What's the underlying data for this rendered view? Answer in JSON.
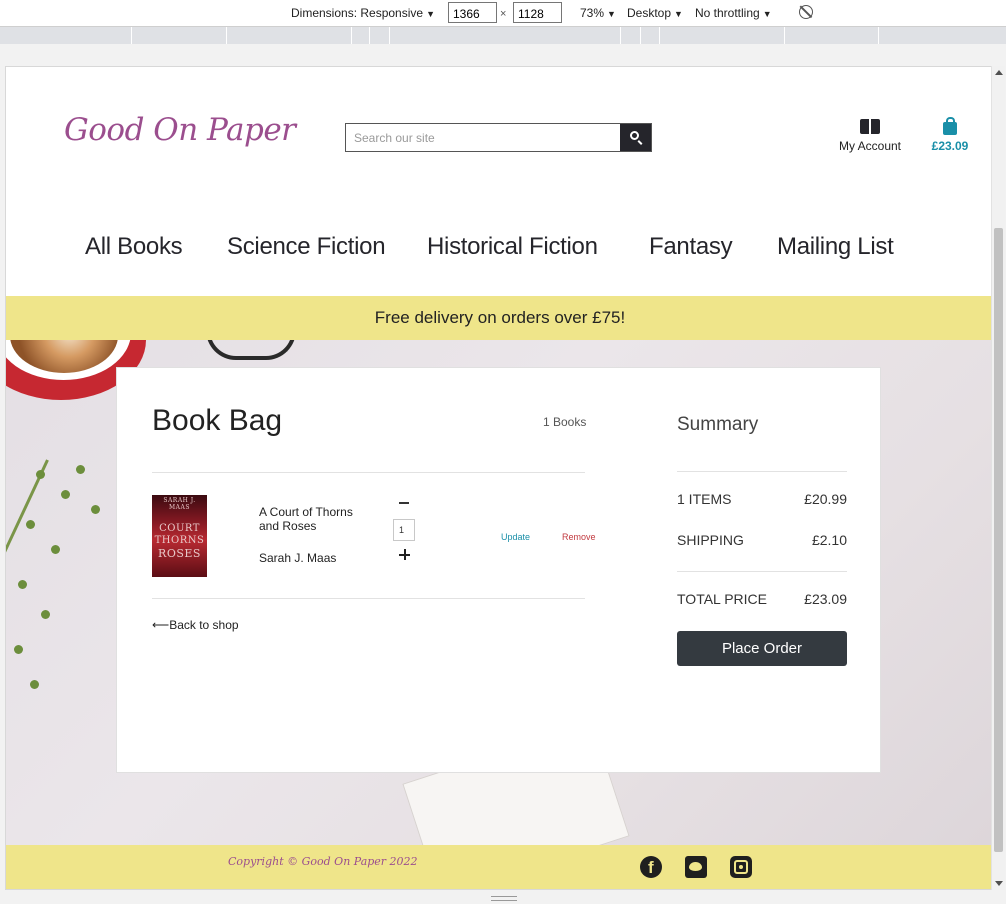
{
  "devtools": {
    "dimensions_label": "Dimensions: Responsive",
    "width_value": "1366",
    "times": "×",
    "height_value": "1128",
    "zoom": "73%",
    "device": "Desktop",
    "throttling": "No throttling",
    "caret": "▼"
  },
  "header": {
    "logo": "Good On Paper",
    "search_placeholder": "Search our site",
    "account_label": "My Account",
    "bag_total": "£23.09"
  },
  "nav": {
    "items": [
      "All Books",
      "Science Fiction",
      "Historical Fiction",
      "Fantasy",
      "Mailing List"
    ]
  },
  "promo": "Free delivery on orders over £75!",
  "bag": {
    "title": "Book Bag",
    "count": "1 Books",
    "item": {
      "title": "A Court of Thorns and Roses",
      "author": "Sarah J. Maas",
      "quantity": "1",
      "update_label": "Update",
      "remove_label": "Remove",
      "cover_text": [
        "SARAH J. MAAS",
        "COURT",
        "THORNS",
        "ROSES"
      ]
    },
    "back_label": "⟵Back to shop"
  },
  "summary": {
    "title": "Summary",
    "items_label": "1 ITEMS",
    "items_value": "£20.99",
    "shipping_label": "SHIPPING",
    "shipping_value": "£2.10",
    "total_label": "TOTAL PRICE",
    "total_value": "£23.09",
    "button_label": "Place Order"
  },
  "footer": {
    "copyright": "Copyright © Good On Paper 2022",
    "social": [
      "facebook-icon",
      "twitter-icon",
      "instagram-icon"
    ]
  },
  "colors": {
    "brand": "#9b4e8e",
    "accent": "#1a8fa8",
    "banner": "#efe58a",
    "button": "#343a40",
    "remove": "#c23a40"
  }
}
